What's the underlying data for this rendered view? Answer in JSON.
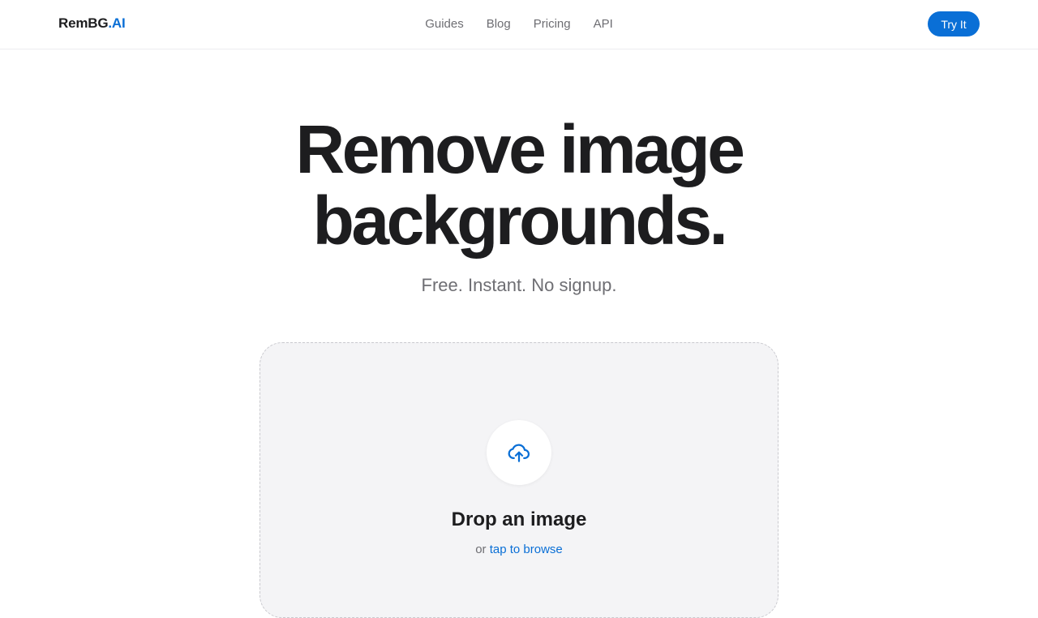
{
  "header": {
    "logo_main": "RemBG",
    "logo_accent": ".AI",
    "nav": [
      {
        "label": "Guides"
      },
      {
        "label": "Blog"
      },
      {
        "label": "Pricing"
      },
      {
        "label": "API"
      }
    ],
    "cta_label": "Try It"
  },
  "hero": {
    "title_line1": "Remove image",
    "title_line2": "backgrounds.",
    "subtitle": "Free. Instant. No signup."
  },
  "dropzone": {
    "icon": "cloud-upload-icon",
    "title": "Drop an image",
    "or_text": "or ",
    "browse_link": "tap to browse"
  },
  "colors": {
    "accent": "#0a6fd6",
    "text": "#1d1d1f",
    "muted": "#6e6e73",
    "dropzone_bg": "#f4f4f6"
  }
}
